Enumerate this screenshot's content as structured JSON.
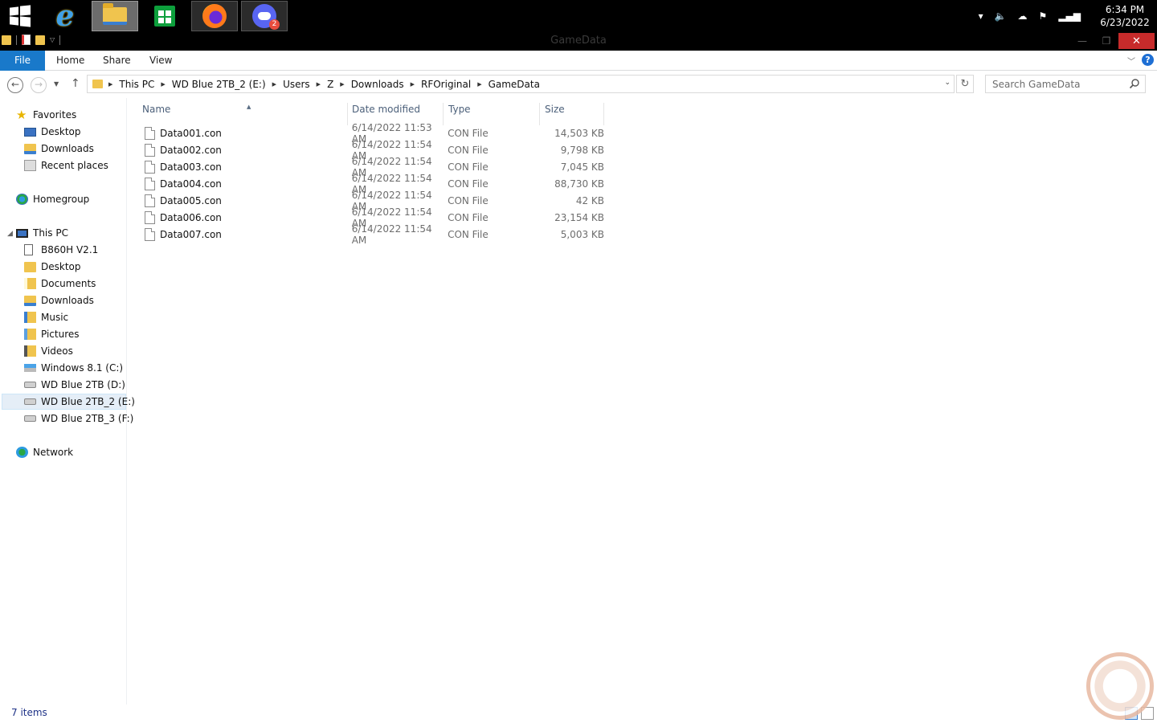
{
  "taskbar": {
    "apps": [
      {
        "name": "Internet Explorer",
        "icon": "internet-explorer-icon"
      },
      {
        "name": "File Explorer",
        "icon": "file-explorer-icon",
        "active": true
      },
      {
        "name": "Store",
        "icon": "store-icon"
      },
      {
        "name": "Firefox",
        "icon": "firefox-icon"
      },
      {
        "name": "Discord",
        "icon": "discord-icon",
        "badge": "2"
      }
    ],
    "tray": {
      "clock_time": "6:34 PM",
      "clock_date": "6/23/2022"
    }
  },
  "window": {
    "title": "GameData"
  },
  "ribbon": {
    "file": "File",
    "home": "Home",
    "share": "Share",
    "view": "View"
  },
  "address": {
    "crumbs": [
      "This PC",
      "WD Blue 2TB_2 (E:)",
      "Users",
      "Z",
      "Downloads",
      "RFOriginal",
      "GameData"
    ],
    "search_placeholder": "Search GameData"
  },
  "nav": {
    "favorites": "Favorites",
    "favorites_items": [
      "Desktop",
      "Downloads",
      "Recent places"
    ],
    "homegroup": "Homegroup",
    "this_pc": "This PC",
    "this_pc_items": [
      "B860H V2.1",
      "Desktop",
      "Documents",
      "Downloads",
      "Music",
      "Pictures",
      "Videos",
      "Windows 8.1 (C:)",
      "WD Blue 2TB (D:)",
      "WD Blue 2TB_2 (E:)",
      "WD Blue 2TB_3 (F:)"
    ],
    "network": "Network",
    "selected": "WD Blue 2TB_2 (E:)"
  },
  "columns": {
    "name": "Name",
    "date": "Date modified",
    "type": "Type",
    "size": "Size"
  },
  "files": [
    {
      "name": "Data001.con",
      "date": "6/14/2022 11:53 AM",
      "type": "CON File",
      "size": "14,503 KB"
    },
    {
      "name": "Data002.con",
      "date": "6/14/2022 11:54 AM",
      "type": "CON File",
      "size": "9,798 KB"
    },
    {
      "name": "Data003.con",
      "date": "6/14/2022 11:54 AM",
      "type": "CON File",
      "size": "7,045 KB"
    },
    {
      "name": "Data004.con",
      "date": "6/14/2022 11:54 AM",
      "type": "CON File",
      "size": "88,730 KB"
    },
    {
      "name": "Data005.con",
      "date": "6/14/2022 11:54 AM",
      "type": "CON File",
      "size": "42 KB"
    },
    {
      "name": "Data006.con",
      "date": "6/14/2022 11:54 AM",
      "type": "CON File",
      "size": "23,154 KB"
    },
    {
      "name": "Data007.con",
      "date": "6/14/2022 11:54 AM",
      "type": "CON File",
      "size": "5,003 KB"
    }
  ],
  "status": {
    "item_count": "7 items"
  }
}
